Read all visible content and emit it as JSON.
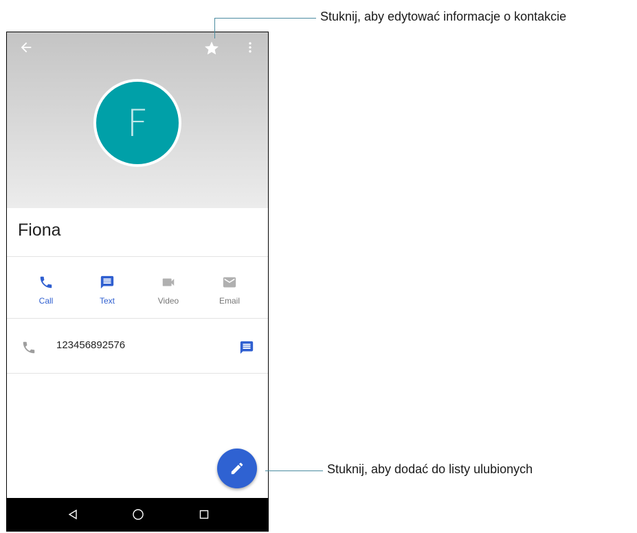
{
  "contact": {
    "initial": "F",
    "name": "Fiona",
    "phone": "123456892576"
  },
  "actions": [
    {
      "label": "Call",
      "icon": "phone-icon",
      "enabled": true
    },
    {
      "label": "Text",
      "icon": "message-icon",
      "enabled": true
    },
    {
      "label": "Video",
      "icon": "video-icon",
      "enabled": false
    },
    {
      "label": "Email",
      "icon": "email-icon",
      "enabled": false
    }
  ],
  "toolbar": {
    "back_icon": "arrow-back-icon",
    "star_icon": "star-icon",
    "menu_icon": "more-vert-icon"
  },
  "fab": {
    "icon": "pencil-icon"
  },
  "navbar": {
    "icons": [
      "back-triangle-icon",
      "home-circle-icon",
      "recents-square-icon"
    ]
  },
  "callouts": {
    "top": "Stuknij, aby edytować informacje o kontakcie",
    "bottom": "Stuknij, aby dodać do listy ulubionych"
  },
  "colors": {
    "accent": "#2f5fd0",
    "avatar": "#00a0a8",
    "fab": "#2f62d2",
    "inactive_icon": "#b0b0b0"
  }
}
